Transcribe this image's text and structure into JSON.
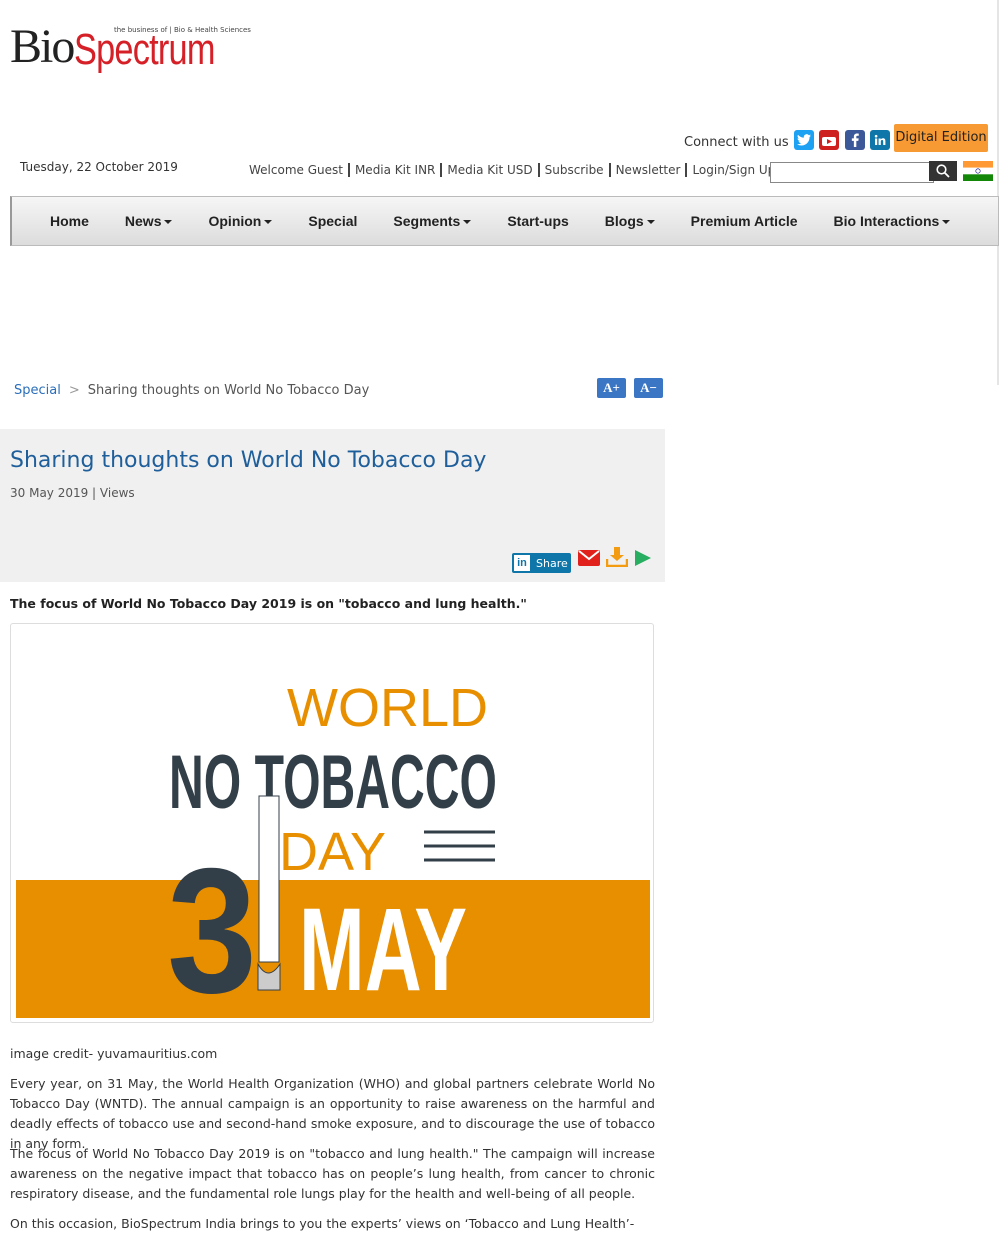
{
  "brand": {
    "name_part1": "Bio",
    "name_part2": "Spectrum",
    "tagline": "the business of | Bio & Health Sciences",
    "accent_color": "#d62027"
  },
  "header": {
    "connect_label": "Connect with us :",
    "social_icons": [
      "twitter-icon",
      "youtube-icon",
      "facebook-icon",
      "linkedin-icon"
    ],
    "digital_edition": "Digital Edition",
    "date": "Tuesday, 22 October 2019",
    "links": [
      "Welcome Guest",
      "Media Kit INR",
      "Media Kit USD",
      "Subscribe",
      "Newsletter",
      "Login/Sign Up"
    ],
    "search_placeholder": ""
  },
  "nav": {
    "items": [
      {
        "label": "Home",
        "dropdown": false
      },
      {
        "label": "News",
        "dropdown": true
      },
      {
        "label": "Opinion",
        "dropdown": true
      },
      {
        "label": "Special",
        "dropdown": false
      },
      {
        "label": "Segments",
        "dropdown": true
      },
      {
        "label": "Start-ups",
        "dropdown": false
      },
      {
        "label": "Blogs",
        "dropdown": true
      },
      {
        "label": "Premium Article",
        "dropdown": false
      },
      {
        "label": "Bio Interactions",
        "dropdown": true
      }
    ]
  },
  "breadcrumb": {
    "section": "Special",
    "current": "Sharing thoughts on World No Tobacco Day"
  },
  "font_controls": {
    "increase": "A+",
    "decrease": "A−"
  },
  "article": {
    "title": "Sharing thoughts on World No Tobacco Day",
    "meta": "30 May 2019 | Views",
    "share_label": "Share",
    "lead": "The focus of World No Tobacco Day 2019 is on \"tobacco and lung health.\"",
    "image": {
      "line1": "WORLD",
      "line2": "NO TOBACCO",
      "line3": "DAY",
      "number": "3",
      "month": "MAY",
      "orange": "#e88f00",
      "dark": "#333f48"
    },
    "image_credit": "image credit- yuvamauritius.com",
    "paragraphs": [
      "Every year, on 31 May, the World Health Organization (WHO) and global partners celebrate World No Tobacco Day (WNTD). The annual campaign is an opportunity to raise awareness on the harmful and deadly effects of tobacco use and second-hand smoke exposure, and to discourage the use of tobacco in any form.",
      "The focus of World No Tobacco Day 2019 is on \"tobacco and lung health.\" The campaign will increase awareness on the negative impact that tobacco has on people’s lung health, from cancer to chronic respiratory disease, and the fundamental role lungs play for the health and well-being of all people.",
      "On this occasion, BioSpectrum India brings to you the experts’ views on ‘Tobacco and Lung Health’-"
    ]
  }
}
